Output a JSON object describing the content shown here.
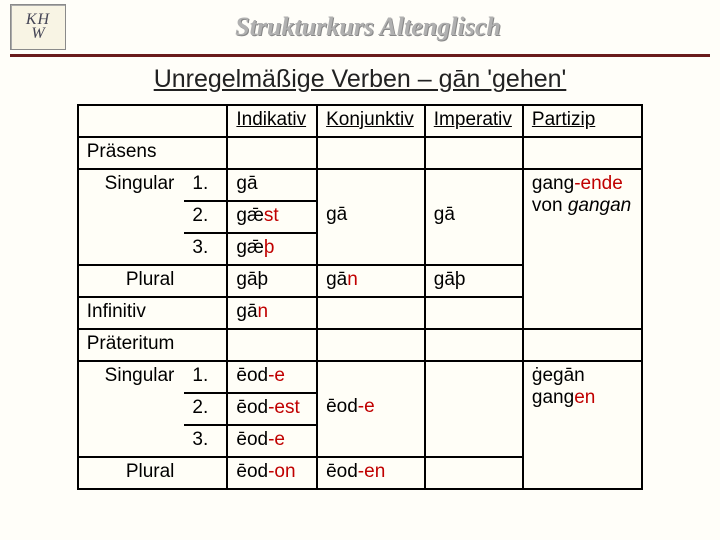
{
  "header": {
    "logo_top": "KH",
    "logo_bottom": "W",
    "course_title": "Strukturkurs Altenglisch"
  },
  "title": "Unregelmäßige Verben – gān 'gehen'",
  "cols": {
    "indikativ": "Indikativ",
    "konjunktiv": "Konjunktiv",
    "imperativ": "Imperativ",
    "partizip": "Partizip"
  },
  "rows": {
    "praesens": "Präsens",
    "singular": "Singular",
    "plural": "Plural",
    "infinitiv": "Infinitiv",
    "praeteritum": "Präteritum",
    "p1": "1.",
    "p2": "2.",
    "p3": "3."
  },
  "praes": {
    "ind": {
      "s1": "gā",
      "s2_base": "gǣ",
      "s2_suf": "st",
      "s3_base": "gǣ",
      "s3_suf": "þ",
      "pl": "gāþ"
    },
    "konj": {
      "s": "gā",
      "pl_base": "gā",
      "pl_suf": "n"
    },
    "imp": {
      "s": "gā",
      "pl": "gāþ"
    },
    "part": {
      "line1a": "gang",
      "line1b": "-ende",
      "line2a": "von ",
      "line2b": "gangan"
    }
  },
  "inf": {
    "base": "gā",
    "suf": "n"
  },
  "praet": {
    "ind": {
      "s1_base": "ēod",
      "s1_suf": "-e",
      "s2_base": "ēod",
      "s2_suf": "-est",
      "s3_base": "ēod",
      "s3_suf": "-e",
      "pl_base": "ēod",
      "pl_suf": "-on"
    },
    "konj": {
      "s_base": "ēod",
      "s_suf": "-e",
      "pl_base": "ēod",
      "pl_suf": "-en"
    },
    "part": {
      "line1": "ġegān",
      "line2a": "gang",
      "line2b": "en"
    }
  }
}
